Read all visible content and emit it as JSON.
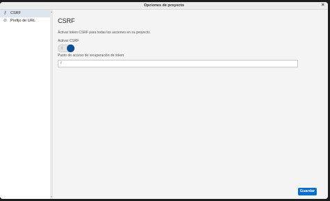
{
  "window": {
    "title": "Opciones de proyecto",
    "close_icon": "close-icon"
  },
  "sidebar": {
    "items": [
      {
        "label": "CSRF",
        "icon": "key-icon",
        "glyph": "⚿",
        "active": true
      },
      {
        "label": "Prefijo de URL",
        "icon": "link-icon",
        "glyph": "🔗",
        "active": false
      }
    ]
  },
  "main": {
    "title": "CSRF",
    "description": "Activar token CSRF para todas las acciones en su proyecto.",
    "toggle": {
      "label": "Activar CSRF",
      "checked": true
    },
    "endpoint": {
      "label": "Punto de acceso de recuperación de token",
      "value": "/"
    },
    "save_label": "Guardar"
  },
  "colors": {
    "accent": "#0a6ed1",
    "toggle_on": "#0a4f93"
  }
}
